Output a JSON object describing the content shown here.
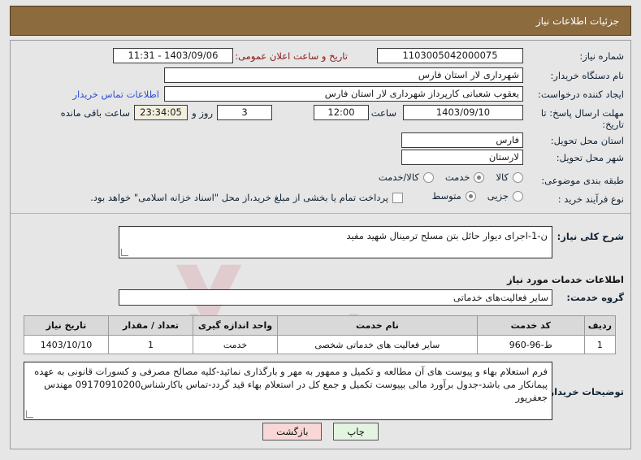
{
  "header": {
    "title": "جزئیات اطلاعات نیاز"
  },
  "colors": {
    "header_bg": "#8c6b3f",
    "page_bg": "#e6e6e6",
    "link": "#2a4fd6",
    "label_red": "#8b1a1a",
    "countdown_bg": "#f2efe0",
    "print_btn_bg": "#e3f5e0",
    "back_btn_bg": "#f9d7d7"
  },
  "watermark": {
    "text": "AriaTender.net"
  },
  "fields": {
    "need_number_label": "شماره نیاز:",
    "need_number_value": "1103005042000075",
    "public_announce_label": "تاریخ و ساعت اعلان عمومی:",
    "public_announce_value": "1403/09/06 - 11:31",
    "buyer_org_label": "نام دستگاه خریدار:",
    "buyer_org_value": "شهرداری لار استان فارس",
    "requester_label": "ایجاد کننده درخواست:",
    "requester_value": "یعقوب شعبانی کارپرداز شهرداری لار استان فارس",
    "buyer_contact_link": "اطلاعات تماس خریدار",
    "deadline_label": "مهلت ارسال پاسخ: تا تاریخ:",
    "deadline_date": "1403/09/10",
    "deadline_hour_label": "ساعت",
    "deadline_hour": "12:00",
    "days_remaining": "3",
    "days_unit_label": "روز و",
    "countdown": "23:34:05",
    "countdown_suffix": "ساعت باقی مانده",
    "province_label": "استان محل تحویل:",
    "province_value": "فارس",
    "city_label": "شهر محل تحویل:",
    "city_value": "لارستان",
    "category_label": "طبقه بندی موضوعی:",
    "process_type_label": "نوع فرآیند خرید :",
    "treasury_note": "پرداخت تمام یا بخشی از مبلغ خرید،از محل \"اسناد خزانه اسلامی\" خواهد بود."
  },
  "category_options": [
    {
      "label": "کالا",
      "selected": false
    },
    {
      "label": "خدمت",
      "selected": true
    },
    {
      "label": "کالا/خدمت",
      "selected": false
    }
  ],
  "process_options": [
    {
      "label": "جزیی",
      "selected": false
    },
    {
      "label": "متوسط",
      "selected": true
    }
  ],
  "treasury_checkbox_checked": false,
  "description": {
    "label": "شرح کلی نیاز:",
    "value": "ن-1-اجرای دیوار حائل بتن مسلح ترمینال شهید مفید"
  },
  "services_section": {
    "title": "اطلاعات خدمات مورد نیاز",
    "group_label": "گروه خدمت:",
    "group_value": "سایر فعالیت‌های خدماتی"
  },
  "table": {
    "headers": [
      "ردیف",
      "کد خدمت",
      "نام خدمت",
      "واحد اندازه گیری",
      "تعداد / مقدار",
      "تاریخ نیاز"
    ],
    "rows": [
      {
        "row_no": "1",
        "service_code": "ط-96-960",
        "service_name": "سایر فعالیت های خدماتی شخصی",
        "unit": "خدمت",
        "quantity": "1",
        "need_date": "1403/10/10"
      }
    ]
  },
  "buyer_notes": {
    "label": "توضیحات خریدار:",
    "value": "فرم استعلام بهاء و پیوست های آن مطالعه و تکمیل و ممهور به مهر و بارگذاری نمائید-کلیه مصالح مصرفی و کسورات قانونی به عهده پیمانکار می باشد-جدول برآورد مالی بپیوست تکمیل و جمع کل در استعلام بهاء قید گردد-تماس باکارشناس09170910200 مهندس جعفرپور"
  },
  "buttons": {
    "print": "چاپ",
    "back": "بازگشت"
  }
}
